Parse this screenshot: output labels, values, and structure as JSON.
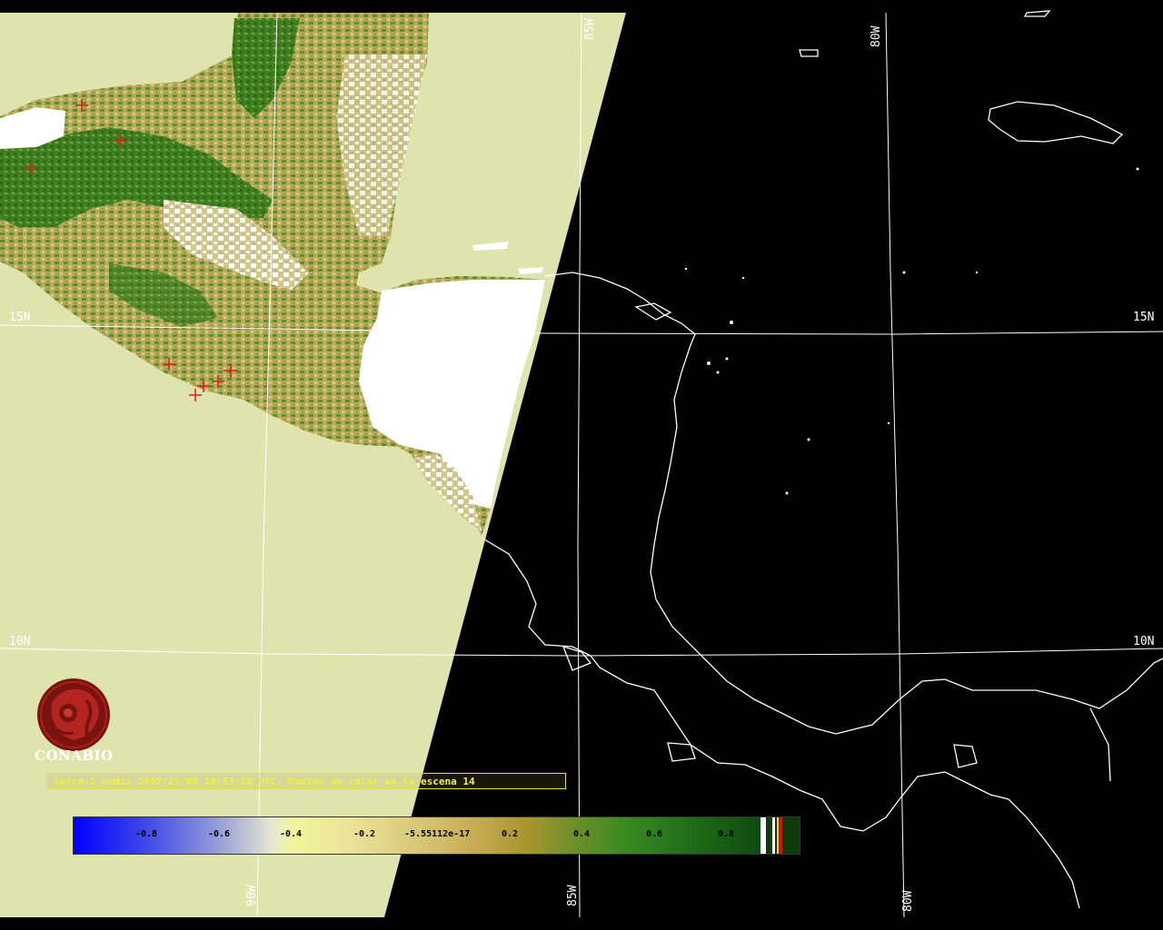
{
  "map": {
    "lat_labels": [
      "15N",
      "10N"
    ],
    "lon_labels": [
      "85W",
      "80W",
      "90W"
    ],
    "colors": {
      "land_veg": "#3f7f1f",
      "land_dry": "#b8a85a",
      "cloud": "#ffffff",
      "sea_day": "#dfe4ae",
      "night": "#000000",
      "hotspot": "#e21b1b",
      "grid": "#ffffff"
    }
  },
  "logo": {
    "text": "CONABIO",
    "icon": "conabio-logo-icon"
  },
  "caption": {
    "text": "terra-1 modis 2007/15/08 16:53:20 UTC, Puntos de calor en la escena 14"
  },
  "colorbar": {
    "ticks": [
      "-0.8",
      "-0.6",
      "-0.4",
      "-0.2",
      "-5.55112e-17",
      "0.2",
      "0.4",
      "0.6",
      "0.8"
    ]
  }
}
